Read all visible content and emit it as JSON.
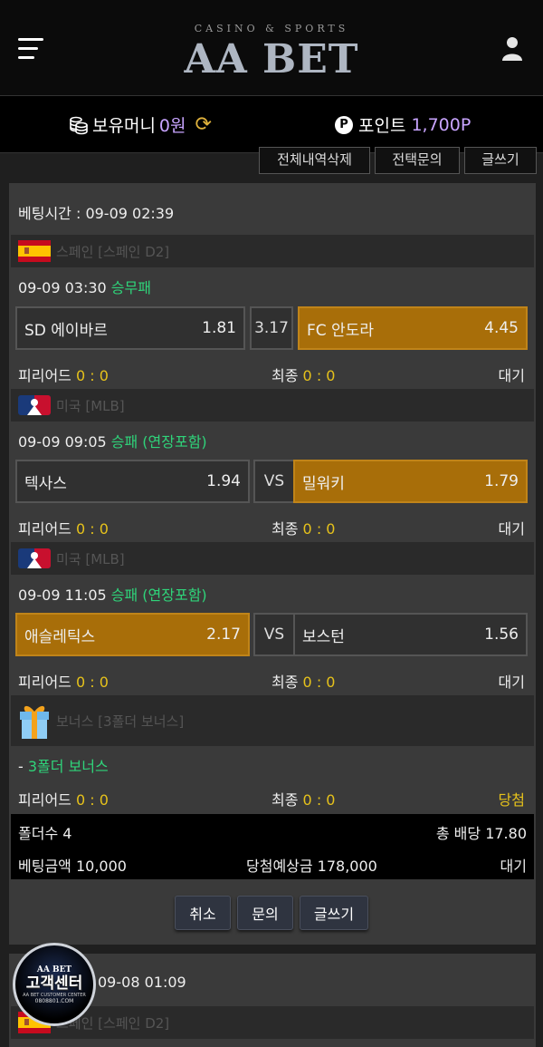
{
  "header": {
    "brand_sub": "CASINO & SPORTS",
    "brand": "AA BET",
    "menu_icon": "hamburger-menu-icon",
    "user_icon": "user-icon"
  },
  "balance": {
    "money_label": "보유머니",
    "money_value": "0원",
    "point_label": "포인트",
    "point_value": "1,700P",
    "point_icon_letter": "P"
  },
  "top_actions": [
    "전체내역삭제",
    "전택문의",
    "글쓰기"
  ],
  "bet1": {
    "bet_time": "베팅시간 : 09-09 02:39",
    "games": [
      {
        "league": "스페인 [스페인 D2]",
        "league_icon": "spain-flag-icon",
        "time": "09-09 03:30",
        "market": "승무패",
        "home": "SD 에이바르",
        "home_odds": "1.81",
        "middle": "3.17",
        "away": "FC 안도라",
        "away_odds": "4.45",
        "selected": "away",
        "period_label": "피리어드",
        "period_score": "0 : 0",
        "final_label": "최종",
        "final_score": "0 : 0",
        "status": "대기"
      },
      {
        "league": "미국 [MLB]",
        "league_icon": "mlb-logo-icon",
        "time": "09-09 09:05",
        "market": "승패 (연장포함)",
        "home": "텍사스",
        "home_odds": "1.94",
        "middle": "VS",
        "away": "밀워키",
        "away_odds": "1.79",
        "selected": "away",
        "period_label": "피리어드",
        "period_score": "0 : 0",
        "final_label": "최종",
        "final_score": "0 : 0",
        "status": "대기"
      },
      {
        "league": "미국 [MLB]",
        "league_icon": "mlb-logo-icon",
        "time": "09-09 11:05",
        "market": "승패 (연장포함)",
        "home": "애슬레틱스",
        "home_odds": "2.17",
        "middle": "VS",
        "away": "보스턴",
        "away_odds": "1.56",
        "selected": "home",
        "period_label": "피리어드",
        "period_score": "0 : 0",
        "final_label": "최종",
        "final_score": "0 : 0",
        "status": "대기"
      }
    ],
    "bonus": {
      "league": "보너스 [3폴더 보너스]",
      "league_icon": "gift-box-icon",
      "dash": "- ",
      "name": "3폴더 보너스",
      "period_label": "피리어드",
      "period_score": "0 : 0",
      "final_label": "최종",
      "final_score": "0 : 0",
      "status": "당첨"
    },
    "summary": {
      "folders": "폴더수 4",
      "total_odds": "총 배당 17.80",
      "bet_amount": "베팅금액 10,000",
      "expected_win": "당첨예상금 178,000",
      "status": "대기"
    },
    "buttons": [
      "취소",
      "문의",
      "글쓰기"
    ]
  },
  "bet2": {
    "bet_time": "09-08 01:09",
    "league": "스페인 [스페인 D2]",
    "league_icon": "spain-flag-icon"
  },
  "cs_badge": {
    "top": "AA BET",
    "main": "고객센터",
    "sub": "AA BET CUSTOMER CENTER",
    "url": "0808801.COM"
  },
  "colors": {
    "selected_odds": "#a86e09",
    "accent_green": "#2fd47a",
    "accent_gold": "#e6c21b",
    "point_purple": "#c8a4ff"
  }
}
